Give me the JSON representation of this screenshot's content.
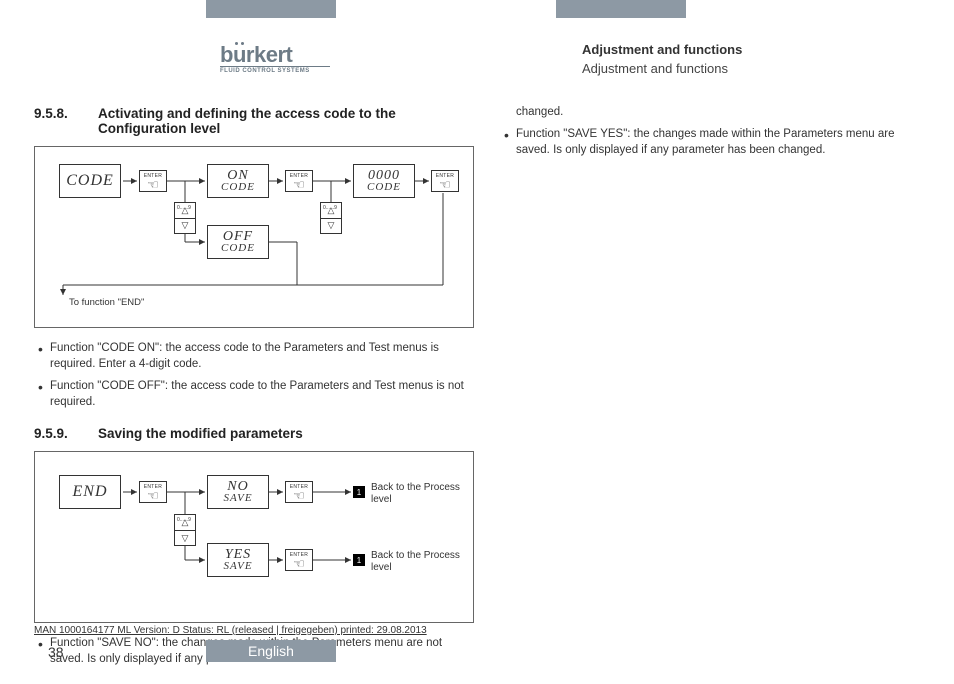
{
  "logo": {
    "brand": "burkert",
    "tagline": "FLUID CONTROL SYSTEMS"
  },
  "header_right": {
    "title": "Adjustment and functions",
    "sub": "Adjustment and functions"
  },
  "section958": {
    "num": "9.5.8.",
    "title": "Activating and defining the access code to the Configuration level",
    "diag": {
      "code": "CODE",
      "on_code_l1": "ON",
      "on_code_l2": "CODE",
      "off_code_l1": "OFF",
      "off_code_l2": "CODE",
      "zero_code_l1": "0000",
      "zero_code_l2": "CODE",
      "enter": "ENTER",
      "updown_range": "0......9",
      "endnote": "To function \"END\""
    },
    "bullets": [
      "Function \"CODE ON\": the access code to the Parameters and Test menus is required. Enter a 4-digit code.",
      "Function \"CODE OFF\": the access code to the Parameters and Test menus is not required."
    ]
  },
  "section959": {
    "num": "9.5.9.",
    "title": "Saving the modified parameters",
    "diag": {
      "end": "END",
      "no_save_l1": "NO",
      "no_save_l2": "SAVE",
      "yes_save_l1": "YES",
      "yes_save_l2": "SAVE",
      "enter": "ENTER",
      "updown_range": "0......9",
      "badge": "1",
      "result1": "Back to the Process level",
      "result2": "Back to the Process level"
    },
    "bullet_left": "Function \"SAVE NO\": the changes made within the Parameters menu are not saved. Is only displayed if any parameter has been"
  },
  "right_col": {
    "cont": "changed.",
    "bullet": "Function \"SAVE YES\": the changes made within the Parameters menu are saved. Is only displayed if any parameter has been changed."
  },
  "footer": {
    "man_line": "MAN  1000164177  ML  Version: D Status: RL (released | freigegeben)  printed: 29.08.2013",
    "page": "38",
    "lang": "English"
  }
}
